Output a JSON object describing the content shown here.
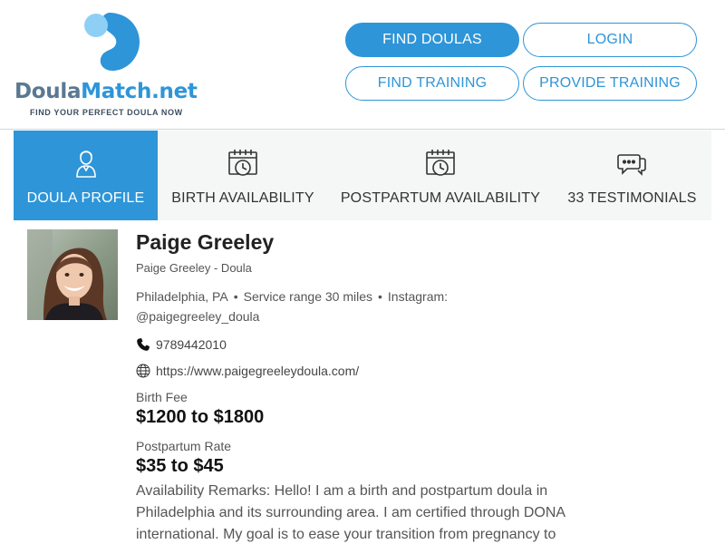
{
  "brand": {
    "name_part1": "Doula",
    "name_part2": "Match.net",
    "tagline": "FIND YOUR PERFECT DOULA NOW",
    "colors": {
      "primary": "#2e95d8",
      "slate": "#5a7892"
    }
  },
  "nav": {
    "find_doulas": "FIND DOULAS",
    "login": "LOGIN",
    "find_training": "FIND TRAINING",
    "provide_training": "PROVIDE TRAINING"
  },
  "tabs": [
    {
      "label": "DOULA PROFILE",
      "icon": "doula-person-icon",
      "active": true
    },
    {
      "label": "BIRTH AVAILABILITY",
      "icon": "calendar-clock-icon",
      "active": false
    },
    {
      "label": "POSTPARTUM AVAILABILITY",
      "icon": "calendar-clock-icon",
      "active": false
    },
    {
      "label": "33 TESTIMONIALS",
      "icon": "chat-bubbles-icon",
      "active": false
    }
  ],
  "profile": {
    "name": "Paige Greeley",
    "subtitle": "Paige Greeley - Doula",
    "location": "Philadelphia, PA",
    "service_range": "Service range 30 miles",
    "instagram_label": "Instagram:",
    "instagram": "@paigegreeley_doula",
    "phone": "9789442010",
    "website": "https://www.paigegreeleydoula.com/",
    "birth_fee_label": "Birth Fee",
    "birth_fee": "$1200 to $1800",
    "postpartum_rate_label": "Postpartum Rate",
    "postpartum_rate": "$35 to $45",
    "remarks": "Availability Remarks: Hello! I am a birth and postpartum doula in Philadelphia and its surrounding area. I am certified through DONA international. My goal is to ease your transition from pregnancy to"
  }
}
